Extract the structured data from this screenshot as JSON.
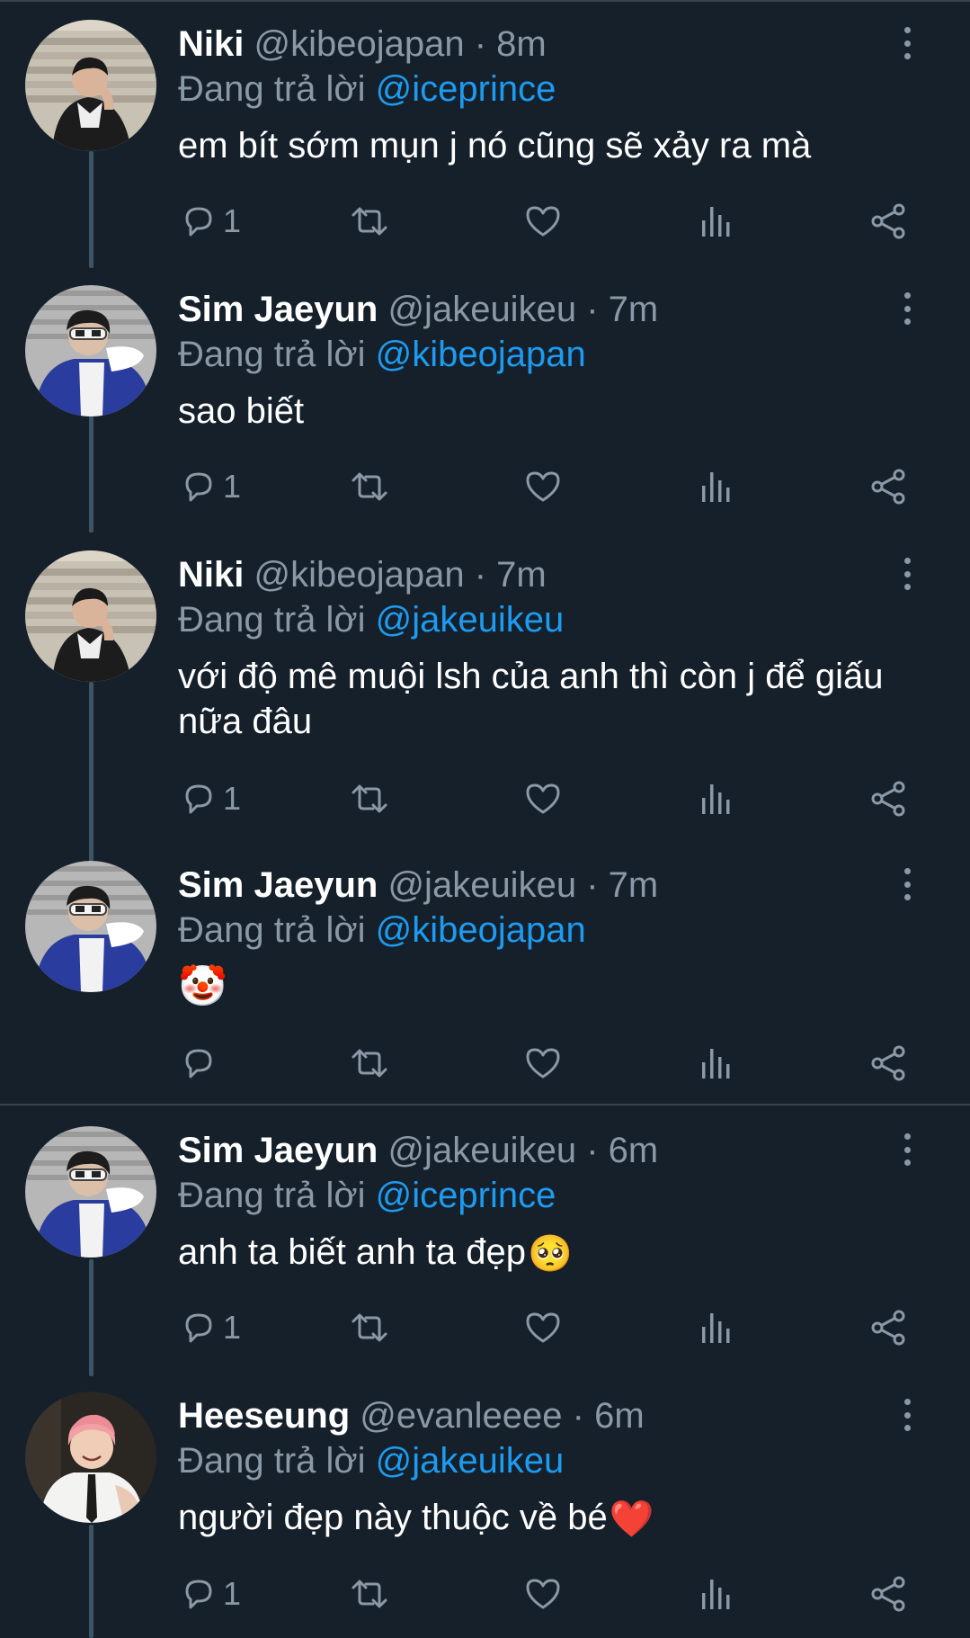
{
  "reply_prefix": "Đang trả lời",
  "tweets": [
    {
      "name": "Niki",
      "handle": "@kibeojapan",
      "sep": "·",
      "time": "8m",
      "reply_to": "@iceprince",
      "text": "em bít sớm mụn j nó cũng sẽ xảy ra mà",
      "reply_count": "1"
    },
    {
      "name": "Sim Jaeyun",
      "handle": "@jakeuikeu",
      "sep": "·",
      "time": "7m",
      "reply_to": "@kibeojapan",
      "text": "sao biết",
      "reply_count": "1"
    },
    {
      "name": "Niki",
      "handle": "@kibeojapan",
      "sep": "·",
      "time": "7m",
      "reply_to": "@jakeuikeu",
      "text": "với độ mê muội lsh của anh thì còn j để giấu nữa đâu",
      "reply_count": "1"
    },
    {
      "name": "Sim Jaeyun",
      "handle": "@jakeuikeu",
      "sep": "·",
      "time": "7m",
      "reply_to": "@kibeojapan",
      "text": "🤡",
      "reply_count": ""
    },
    {
      "name": "Sim Jaeyun",
      "handle": "@jakeuikeu",
      "sep": "·",
      "time": "6m",
      "reply_to": "@iceprince",
      "text": "anh ta biết anh ta đẹp",
      "emoji": "🥺",
      "reply_count": "1"
    },
    {
      "name": "Heeseung",
      "handle": "@evanleeee",
      "sep": "·",
      "time": "6m",
      "reply_to": "@jakeuikeu",
      "text": "người đẹp này thuộc về bé",
      "emoji": "❤️",
      "reply_count": "1"
    }
  ],
  "icons": {
    "reply": "reply-icon",
    "retweet": "retweet-icon",
    "like": "heart-icon",
    "views": "views-icon",
    "share": "share-icon",
    "menu": "more-vertical-icon"
  },
  "colors": {
    "background": "#15202b",
    "accent": "#1d9bf0",
    "muted": "#8b98a5",
    "divider": "#38444d",
    "thread_line": "#3d5466"
  }
}
